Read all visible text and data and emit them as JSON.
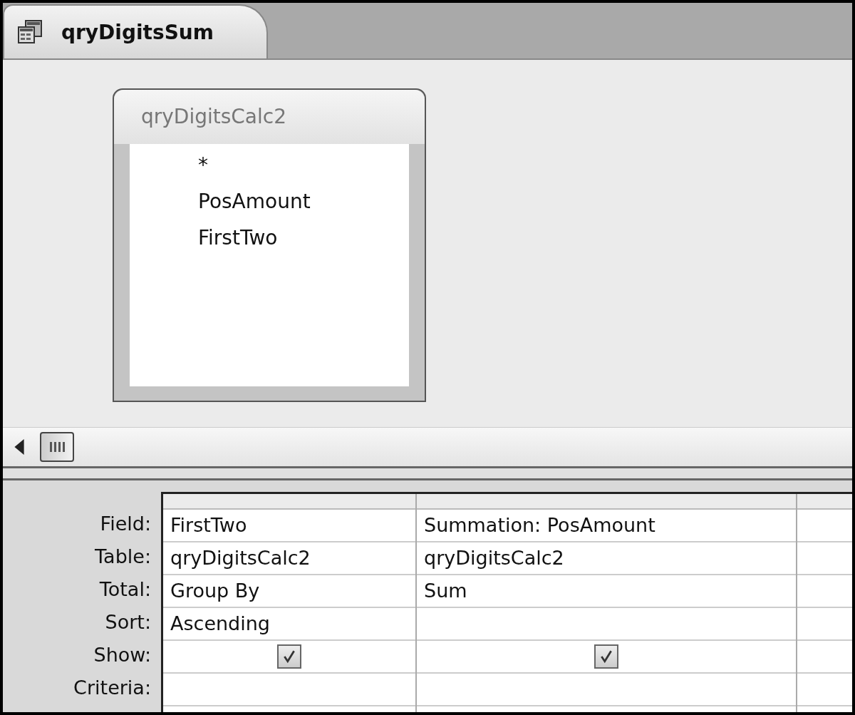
{
  "tab": {
    "title": "qryDigitsSum",
    "selected": true
  },
  "table_box": {
    "title": "qryDigitsCalc2",
    "fields": [
      "*",
      "PosAmount",
      "FirstTwo"
    ]
  },
  "grid": {
    "rows": [
      {
        "label": "Field:",
        "kind": "text"
      },
      {
        "label": "Table:",
        "kind": "text"
      },
      {
        "label": "Total:",
        "kind": "text"
      },
      {
        "label": "Sort:",
        "kind": "text"
      },
      {
        "label": "Show:",
        "kind": "check"
      },
      {
        "label": "Criteria:",
        "kind": "text"
      }
    ],
    "columns": [
      {
        "cells": [
          "FirstTwo",
          "qryDigitsCalc2",
          "Group By",
          "Ascending",
          true
        ]
      },
      {
        "cells": [
          "Summation: PosAmount",
          "qryDigitsCalc2",
          "Sum",
          null,
          true
        ]
      }
    ]
  }
}
